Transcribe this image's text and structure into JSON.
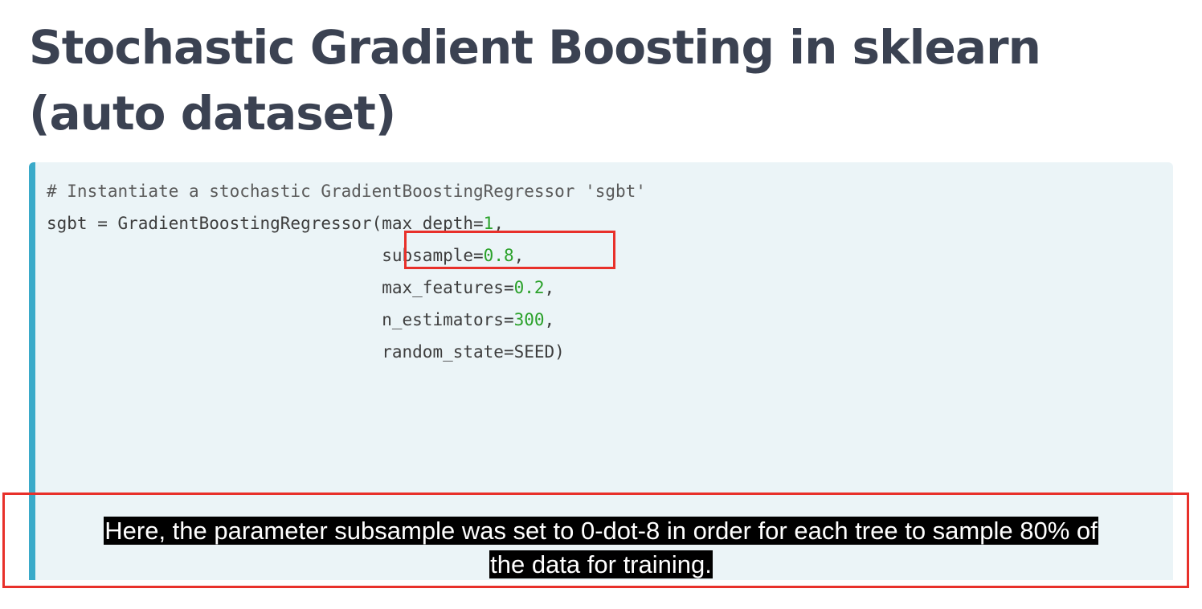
{
  "title": "Stochastic Gradient Boosting in sklearn (auto dataset)",
  "code": {
    "comment": "# Instantiate a stochastic GradientBoostingRegressor 'sgbt'",
    "line1_prefix": "sgbt = GradientBoostingRegressor(max_depth=",
    "line1_value": "1",
    "line1_suffix": ",",
    "indent": "                                 ",
    "line2_prefix": "subsample=",
    "line2_value": "0.8",
    "line2_suffix": ",",
    "line3_prefix": "max_features=",
    "line3_value": "0.2",
    "line3_suffix": ",",
    "line4_prefix": "n_estimators=",
    "line4_value": "300",
    "line4_suffix": ",",
    "line5": "random_state=SEED)"
  },
  "caption": {
    "line1": "Here, the parameter subsample was set to 0-dot-8 in order for each tree to sample 80% of",
    "line2": "the data for training."
  },
  "colors": {
    "accent_bar": "#3aaac9",
    "code_background": "#ebf4f7",
    "highlight_border": "#e8302a",
    "number_literal": "#2aa12a",
    "title_text": "#3b4252"
  }
}
